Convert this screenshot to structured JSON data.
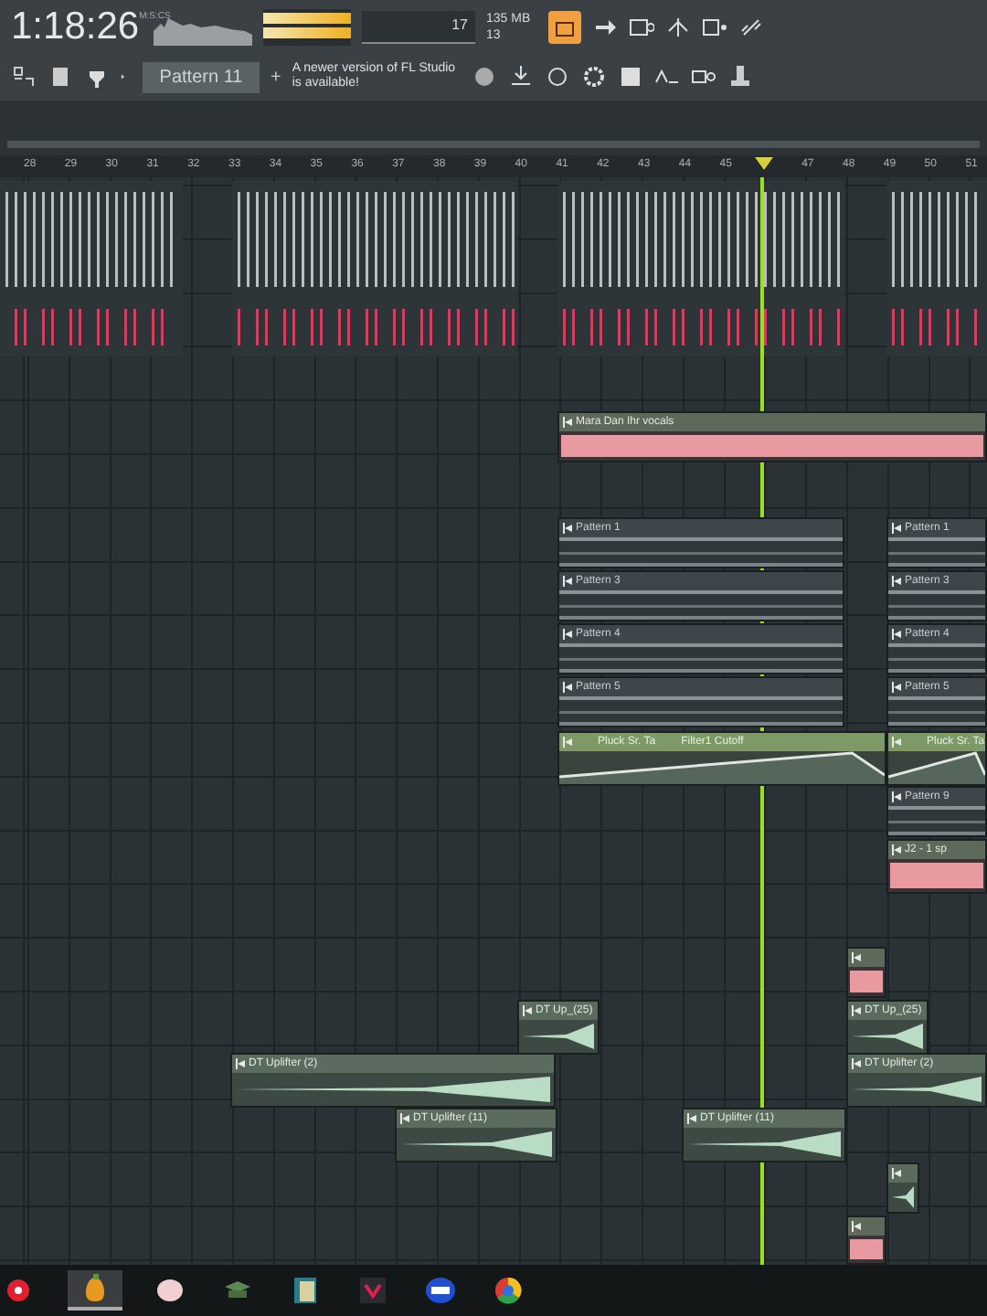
{
  "toolbar": {
    "time": "1:18:26",
    "time_unit": "M:S:CS",
    "tempo": "17",
    "memory": "135 MB",
    "cpu": "13",
    "pattern": "Pattern 11",
    "pattern_add": "+",
    "notice": "A newer version of FL Studio is available!"
  },
  "ruler": {
    "bars_before_marker": [
      "28",
      "29",
      "30",
      "31",
      "32",
      "33",
      "34",
      "35",
      "36",
      "37",
      "38",
      "39",
      "40",
      "41",
      "42",
      "43",
      "44",
      "45"
    ],
    "bars_after_marker": [
      "47",
      "48",
      "49",
      "50",
      "51"
    ]
  },
  "clips": [
    {
      "kind": "vocal",
      "name": "Mara Dan Ihr vocals"
    },
    {
      "kind": "pattern",
      "name": "Pattern 1"
    },
    {
      "kind": "pattern",
      "name": "Pattern 1"
    },
    {
      "kind": "pattern",
      "name": "Pattern 3"
    },
    {
      "kind": "pattern",
      "name": "Pattern 3"
    },
    {
      "kind": "pattern",
      "name": "Pattern 4"
    },
    {
      "kind": "pattern",
      "name": "Pattern 4"
    },
    {
      "kind": "pattern",
      "name": "Pattern 5"
    },
    {
      "kind": "pattern",
      "name": "Pattern 5"
    },
    {
      "kind": "automation",
      "name": "Pluck Sr. Ta",
      "parameter": "Filter1 Cutoff"
    },
    {
      "kind": "automation",
      "name": "Pluck Sr. Ta"
    },
    {
      "kind": "pattern",
      "name": "Pattern 9"
    },
    {
      "kind": "vocal",
      "name": "J2 - 1 sp"
    },
    {
      "kind": "vocal"
    },
    {
      "kind": "audio",
      "name": "DT Up_(25)"
    },
    {
      "kind": "audio",
      "name": "DT Up_(25)"
    },
    {
      "kind": "audio",
      "name": "DT Uplifter (2)"
    },
    {
      "kind": "audio",
      "name": "DT Uplifter (2)"
    },
    {
      "kind": "audio",
      "name": "DT Uplifter (11)"
    },
    {
      "kind": "audio",
      "name": "DT Uplifter (11)"
    },
    {
      "kind": "audio"
    },
    {
      "kind": "vocal"
    }
  ]
}
